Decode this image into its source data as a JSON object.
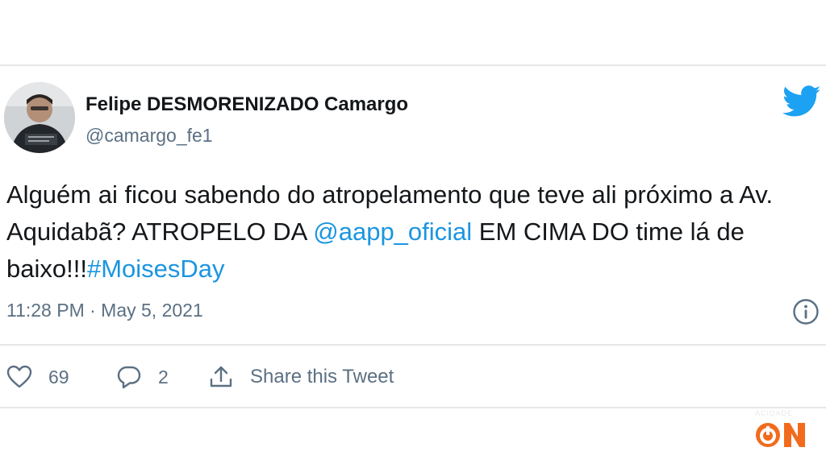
{
  "tweet": {
    "author": {
      "display_name": "Felipe DESMORENIZADO Camargo",
      "handle": "@camargo_fe1"
    },
    "text": {
      "line_part1": "Alguém ai ficou sabendo do atropelamento que teve ali próximo a Av. Aquidabã? ATROPELO DA ",
      "mention": "@aapp_oficial",
      "line_part2": " EM CIMA DO time lá de baixo!!!",
      "hashtag": "#MoisesDay"
    },
    "timestamp": "11:28 PM · May 5, 2021",
    "actions": {
      "like_count": "69",
      "reply_count": "2",
      "share_label": "Share this Tweet"
    }
  },
  "watermark": {
    "logo_text": "ON",
    "tagline": "ACIDADE"
  },
  "colors": {
    "link": "#1b95e0",
    "twitter_blue": "#1da1f2",
    "secondary_text": "#5b7083",
    "watermark_orange": "#f26b1d"
  },
  "icons": {
    "brand": "twitter-bird-icon",
    "info": "info-icon",
    "like": "heart-icon",
    "reply": "reply-bubble-icon",
    "share": "share-icon"
  }
}
